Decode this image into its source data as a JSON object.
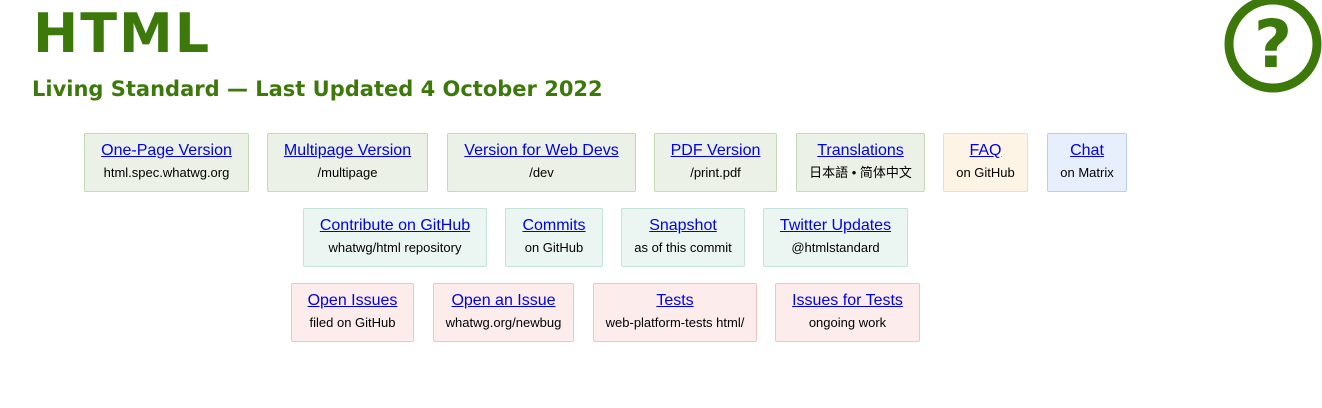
{
  "header": {
    "title": "HTML",
    "subtitle": "Living Standard — Last Updated 4 October 2022",
    "help_icon": "question-mark-circle-icon",
    "accent_color": "#3c790a"
  },
  "rows": [
    [
      {
        "label": "One-Page Version",
        "sub": "html.spec.whatwg.org"
      },
      {
        "label": "Multipage Version",
        "sub": "/multipage"
      },
      {
        "label": "Version for Web Devs",
        "sub": "/dev"
      },
      {
        "label": "PDF Version",
        "sub": "/print.pdf"
      },
      {
        "label": "Translations",
        "sub": "日本語 • 简体中文"
      },
      {
        "label": "FAQ",
        "sub": "on GitHub"
      },
      {
        "label": "Chat",
        "sub": "on Matrix"
      }
    ],
    [
      {
        "label": "Contribute on GitHub",
        "sub": "whatwg/html repository"
      },
      {
        "label": "Commits",
        "sub": "on GitHub"
      },
      {
        "label": "Snapshot",
        "sub": "as of this commit"
      },
      {
        "label": "Twitter Updates",
        "sub": "@htmlstandard"
      }
    ],
    [
      {
        "label": "Open Issues",
        "sub": "filed on GitHub"
      },
      {
        "label": "Open an Issue",
        "sub": "whatwg.org/newbug"
      },
      {
        "label": "Tests",
        "sub": "web-platform-tests html/"
      },
      {
        "label": "Issues for Tests",
        "sub": "ongoing work"
      }
    ]
  ]
}
